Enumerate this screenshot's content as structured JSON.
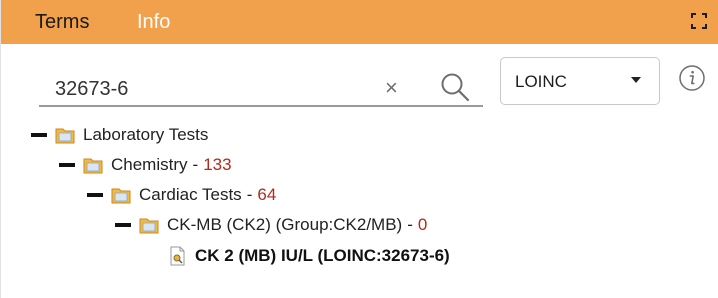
{
  "header": {
    "tabs": [
      {
        "label": "Terms",
        "active": true
      },
      {
        "label": "Info",
        "active": false
      }
    ],
    "expand_icon": "fullscreen-icon",
    "color": "#f1a04c"
  },
  "search": {
    "value": "32673-6",
    "clear_label": "×",
    "search_icon": "magnifier-icon"
  },
  "vocabulary": {
    "selected": "LOINC",
    "dropdown_icon": "caret-down-icon"
  },
  "info_icon": "info-circle-icon",
  "tree": [
    {
      "label": "Laboratory Tests",
      "separator": "",
      "count": "",
      "type": "folder"
    },
    {
      "label": "Chemistry",
      "separator": "-",
      "count": "133",
      "type": "folder"
    },
    {
      "label": "Cardiac Tests",
      "separator": "-",
      "count": "64",
      "type": "folder"
    },
    {
      "label": "CK-MB (CK2) (Group:CK2/MB)",
      "separator": "-",
      "count": "0",
      "type": "folder"
    },
    {
      "label": "CK 2 (MB) IU/L (LOINC:32673-6)",
      "separator": "",
      "count": "",
      "type": "term"
    }
  ],
  "colors": {
    "count": "#b02a1f",
    "folder": "#f5b942"
  }
}
